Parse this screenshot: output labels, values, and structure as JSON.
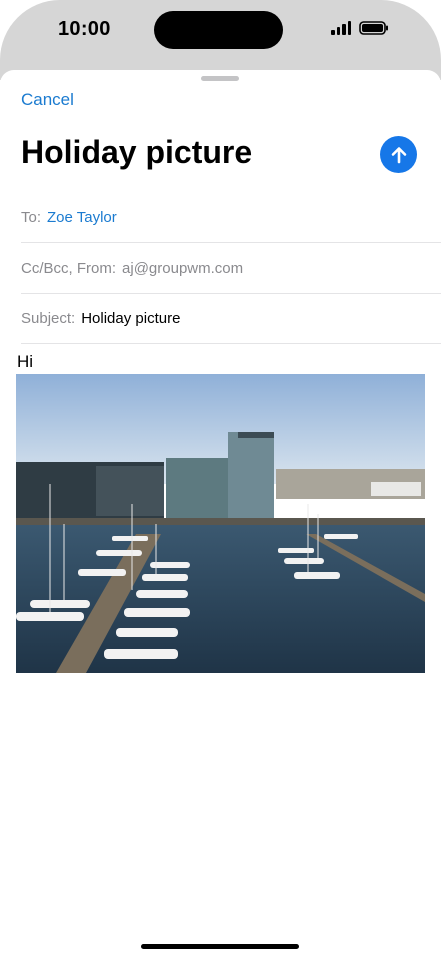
{
  "status_bar": {
    "time": "10:00"
  },
  "compose": {
    "cancel_label": "Cancel",
    "title": "Holiday picture",
    "to_label": "To:",
    "to_value": "Zoe Taylor",
    "ccbcc_label": "Cc/Bcc, From:",
    "from_value": "aj@groupwm.com",
    "subject_label": "Subject:",
    "subject_value": "Holiday picture",
    "body_text": "Hi"
  },
  "icons": {
    "send": "arrow-up-icon",
    "signal": "cellular-signal-icon",
    "battery": "battery-icon"
  },
  "colors": {
    "accent": "#1677e8",
    "link": "#1b7bd0"
  }
}
